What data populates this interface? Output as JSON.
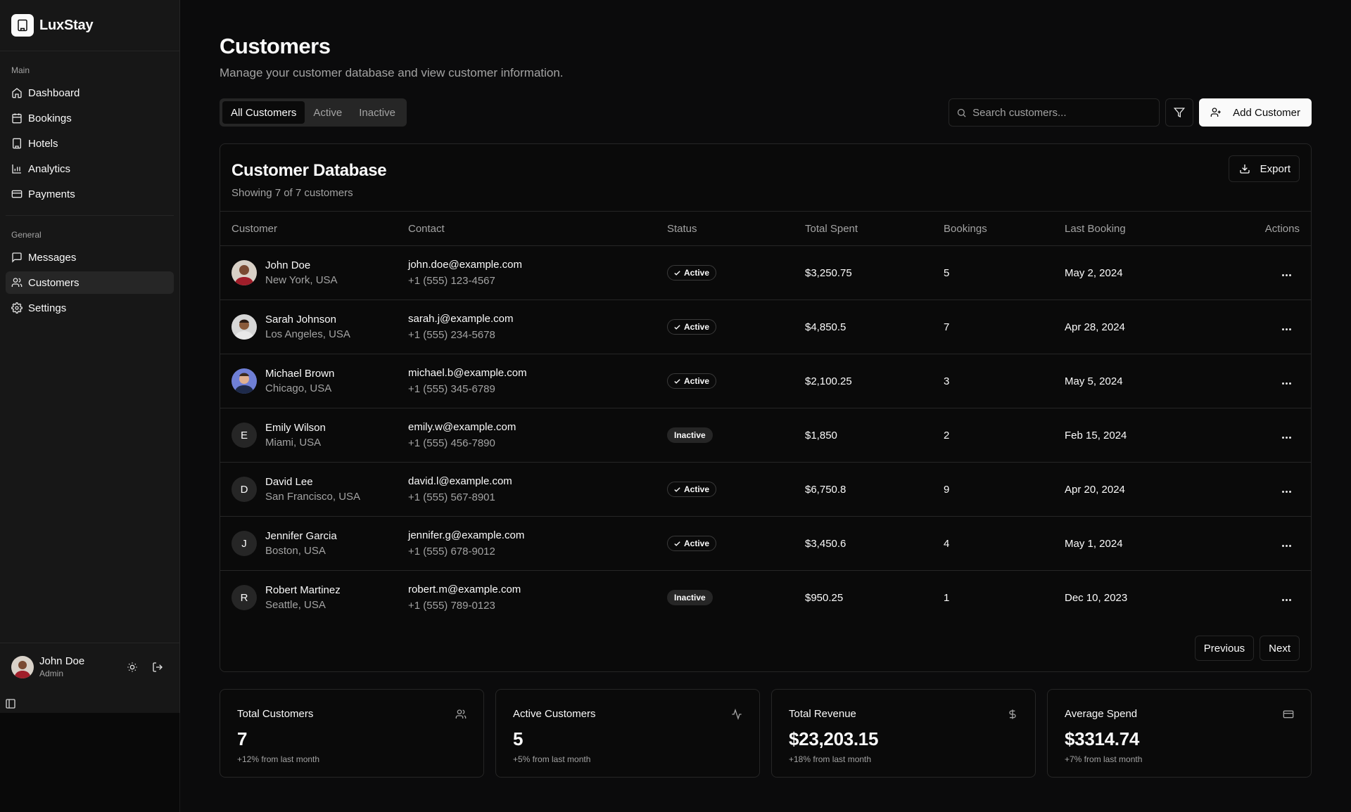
{
  "app": {
    "name": "LuxStay"
  },
  "sidebar": {
    "groups": [
      {
        "label": "Main",
        "items": [
          {
            "label": "Dashboard",
            "icon": "home-icon"
          },
          {
            "label": "Bookings",
            "icon": "calendar-icon"
          },
          {
            "label": "Hotels",
            "icon": "building-icon"
          },
          {
            "label": "Analytics",
            "icon": "bar-chart-icon"
          },
          {
            "label": "Payments",
            "icon": "credit-card-icon"
          }
        ]
      },
      {
        "label": "General",
        "items": [
          {
            "label": "Messages",
            "icon": "message-icon"
          },
          {
            "label": "Customers",
            "icon": "users-icon",
            "active": true
          },
          {
            "label": "Settings",
            "icon": "gear-icon"
          }
        ]
      }
    ],
    "user": {
      "name": "John Doe",
      "role": "Admin"
    }
  },
  "page": {
    "title": "Customers",
    "subtitle": "Manage your customer database and view customer information."
  },
  "tabs": [
    {
      "label": "All Customers",
      "active": true
    },
    {
      "label": "Active"
    },
    {
      "label": "Inactive"
    }
  ],
  "toolbar": {
    "search_placeholder": "Search customers...",
    "add_label": "Add Customer"
  },
  "card": {
    "title": "Customer Database",
    "subtitle": "Showing 7 of 7 customers",
    "export_label": "Export"
  },
  "table": {
    "columns": [
      "Customer",
      "Contact",
      "Status",
      "Total Spent",
      "Bookings",
      "Last Booking",
      "Actions"
    ],
    "rows": [
      {
        "name": "John Doe",
        "location": "New York, USA",
        "email": "john.doe@example.com",
        "phone": "+1 (555) 123-4567",
        "status": "Active",
        "spent": "$3,250.75",
        "bookings": "5",
        "last": "May 2, 2024",
        "avatar": "photo",
        "initial": ""
      },
      {
        "name": "Sarah Johnson",
        "location": "Los Angeles, USA",
        "email": "sarah.j@example.com",
        "phone": "+1 (555) 234-5678",
        "status": "Active",
        "spent": "$4,850.5",
        "bookings": "7",
        "last": "Apr 28, 2024",
        "avatar": "photo",
        "initial": ""
      },
      {
        "name": "Michael Brown",
        "location": "Chicago, USA",
        "email": "michael.b@example.com",
        "phone": "+1 (555) 345-6789",
        "status": "Active",
        "spent": "$2,100.25",
        "bookings": "3",
        "last": "May 5, 2024",
        "avatar": "photo",
        "initial": ""
      },
      {
        "name": "Emily Wilson",
        "location": "Miami, USA",
        "email": "emily.w@example.com",
        "phone": "+1 (555) 456-7890",
        "status": "Inactive",
        "spent": "$1,850",
        "bookings": "2",
        "last": "Feb 15, 2024",
        "avatar": "initial",
        "initial": "E"
      },
      {
        "name": "David Lee",
        "location": "San Francisco, USA",
        "email": "david.l@example.com",
        "phone": "+1 (555) 567-8901",
        "status": "Active",
        "spent": "$6,750.8",
        "bookings": "9",
        "last": "Apr 20, 2024",
        "avatar": "initial",
        "initial": "D"
      },
      {
        "name": "Jennifer Garcia",
        "location": "Boston, USA",
        "email": "jennifer.g@example.com",
        "phone": "+1 (555) 678-9012",
        "status": "Active",
        "spent": "$3,450.6",
        "bookings": "4",
        "last": "May 1, 2024",
        "avatar": "initial",
        "initial": "J"
      },
      {
        "name": "Robert Martinez",
        "location": "Seattle, USA",
        "email": "robert.m@example.com",
        "phone": "+1 (555) 789-0123",
        "status": "Inactive",
        "spent": "$950.25",
        "bookings": "1",
        "last": "Dec 10, 2023",
        "avatar": "initial",
        "initial": "R"
      }
    ]
  },
  "pagination": {
    "previous": "Previous",
    "next": "Next"
  },
  "stats": [
    {
      "label": "Total Customers",
      "value": "7",
      "delta": "+12% from last month",
      "icon": "users-icon"
    },
    {
      "label": "Active Customers",
      "value": "5",
      "delta": "+5% from last month",
      "icon": "activity-icon"
    },
    {
      "label": "Total Revenue",
      "value": "$23,203.15",
      "delta": "+18% from last month",
      "icon": "dollar-icon"
    },
    {
      "label": "Average Spend",
      "value": "$3314.74",
      "delta": "+7% from last month",
      "icon": "credit-card-icon"
    }
  ]
}
